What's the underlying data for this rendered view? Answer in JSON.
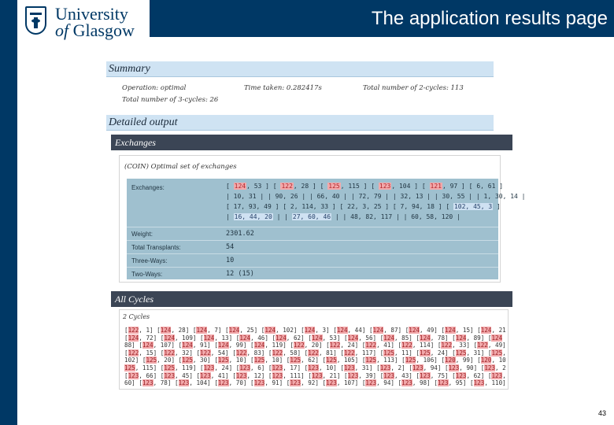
{
  "header": {
    "logo_line1": "University",
    "logo_line2_prefix": "of ",
    "logo_line2": "Glasgow",
    "slide_title": "The application results page",
    "page_number": "43"
  },
  "summary": {
    "title": "Summary",
    "operation": "Operation: optimal",
    "time_taken": "Time taken: 0.282417s",
    "total_two_cycles": "Total number of 2-cycles: 113",
    "total_three_cycles": "Total number of 3-cycles: 26"
  },
  "detailed": {
    "title": "Detailed output",
    "exchanges_header": "Exchanges",
    "exchanges_panel_title": "(COIN) Optimal set of exchanges",
    "rows": [
      {
        "label": "Exchanges:",
        "value": ""
      },
      {
        "label": "Weight:",
        "value": "2301.62"
      },
      {
        "label": "Total Transplants:",
        "value": "54"
      },
      {
        "label": "Three-Ways:",
        "value": "10"
      },
      {
        "label": "Two-Ways:",
        "value": "12 (15)"
      }
    ],
    "exchange_lines": [
      [
        {
          "t": "[ ",
          "h": ""
        },
        {
          "t": "124",
          "h": "red"
        },
        {
          "t": ", 53 ] [ ",
          "h": ""
        },
        {
          "t": "122",
          "h": "red"
        },
        {
          "t": ", 28 ] [ ",
          "h": ""
        },
        {
          "t": "125",
          "h": "red"
        },
        {
          "t": ", 115 ] [ ",
          "h": ""
        },
        {
          "t": "123",
          "h": "red"
        },
        {
          "t": ", 104 ] [ ",
          "h": ""
        },
        {
          "t": "121",
          "h": "red"
        },
        {
          "t": ", 97 ] [ 6, 61 ]",
          "h": ""
        }
      ],
      [
        {
          "t": "| 10, 31 | | 90, 26 | | 66, 40 | | 72, 79 | | 32, 13 | | 30, 55 | | 1, 30, 14 |",
          "h": ""
        }
      ],
      [
        {
          "t": "[ 17, 93, 49 ] [ 2, 114, 33 ] [ 22, 3, 25 ] [ 7, 94, 18 ] [ ",
          "h": ""
        },
        {
          "t": "102, 45, 3",
          "h": "blue"
        },
        {
          "t": " ]",
          "h": ""
        }
      ],
      [
        {
          "t": "| ",
          "h": ""
        },
        {
          "t": "16, 44, 20",
          "h": "blue"
        },
        {
          "t": " | | ",
          "h": ""
        },
        {
          "t": "27, 60, 46",
          "h": "blue"
        },
        {
          "t": " | | 48, 82, 117 | | 60, 58, 120 |",
          "h": ""
        }
      ]
    ],
    "all_cycles_header": "All Cycles",
    "cycles_panel_title": "2 Cycles",
    "cycle_lines": [
      "[122, 1] [124, 28] [124, 7] [124, 25] [124, 102] [124, 3] [124, 44] [124, 87] [124, 49] [124, 15] [124, 21]",
      "[124, 72] [124, 109] [124, 13] [124, 46] [124, 62] [124, 53] [124, 56] [124, 85] [124, 78] [124, 89] [124",
      "88] [124, 107] [124, 91] [124, 99] [124, 119] [122, 20] [122, 24] [122, 41] [122, 114] [122, 33] [122, 49]",
      "[122, 15] [122, 32] [122, 54] [122, 83] [122, 58] [122, 81] [122, 117] [125, 11] [125, 24] [125, 31] [125,",
      "102] [125, 20] [125, 30] [125, 10] [125, 10] [125, 62] [125, 105] [125, 113] [125, 106] [120, 99] [120, 100]",
      "125, 115] [125, 119] [123, 24] [123, 6] [123, 17] [123, 10] [123, 31] [123, 2] [123, 94] [123, 90] [123, 20]",
      "[123, 66] [123, 45] [123, 41] [123, 12] [123, 111] [123, 21] [123, 39] [123, 43] [123, 75] [123, 62] [123,",
      "60] [123, 78] [123, 104] [123, 70] [123, 91] [123, 92] [123, 107] [123, 94] [123, 98] [123, 95] [123, 110]"
    ]
  }
}
